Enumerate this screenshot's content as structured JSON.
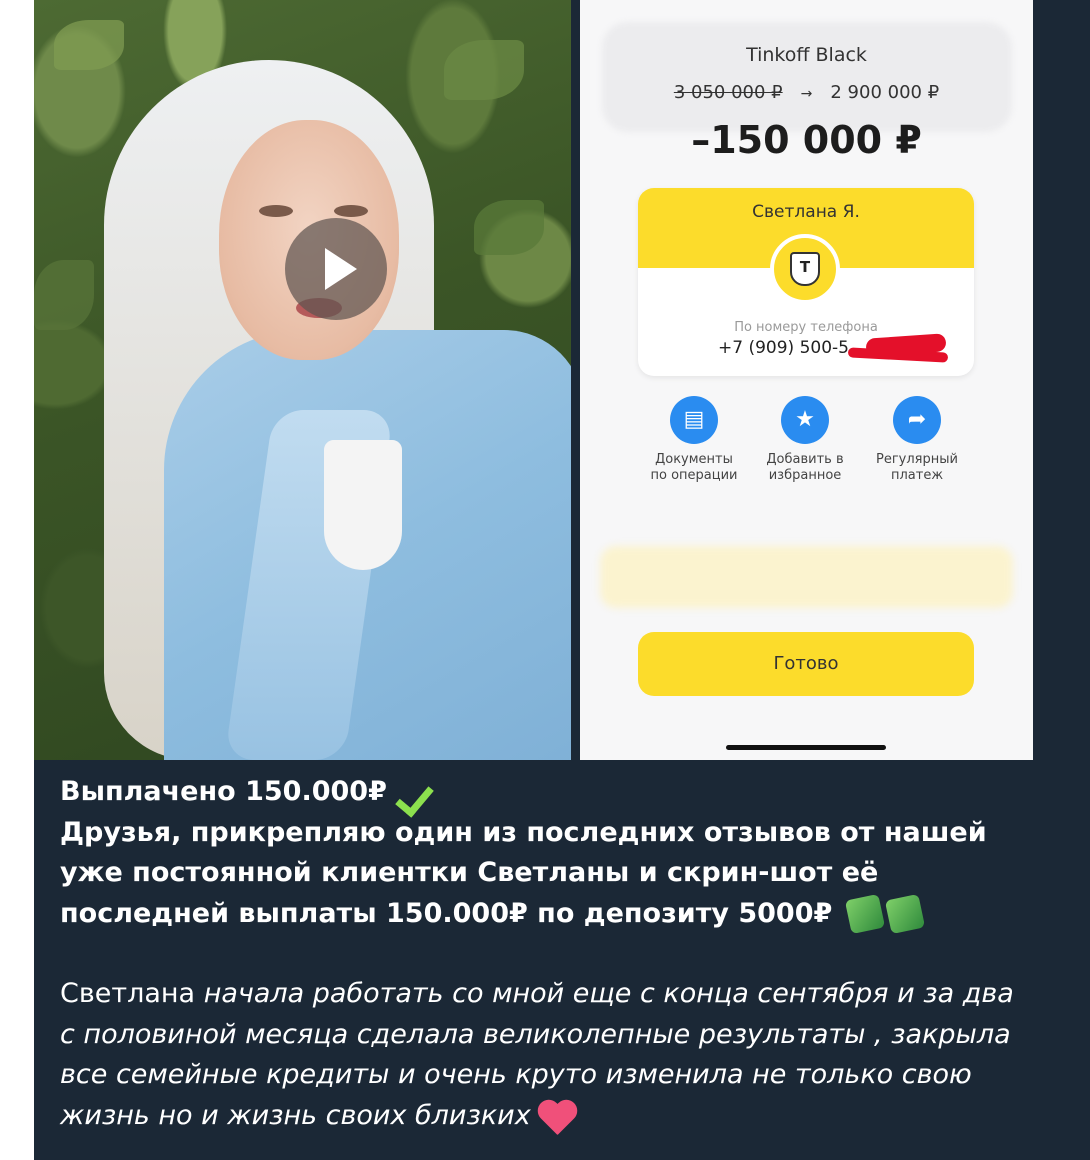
{
  "video": {
    "play_button": "play"
  },
  "phone": {
    "account_name": "Tinkoff Black",
    "balance_old": "3 050 000 ₽",
    "balance_arrow": "→",
    "balance_new": "2 900 000 ₽",
    "amount": "–150 000 ₽",
    "recipient_name": "Светлана Я.",
    "logo_letter": "Т",
    "phone_caption": "По номеру телефона",
    "phone_number": "+7 (909) 500-5",
    "actions": [
      {
        "icon": "document-icon",
        "glyph": "▤",
        "line1": "Документы",
        "line2": "по операции"
      },
      {
        "icon": "star-icon",
        "glyph": "★",
        "line1": "Добавить в",
        "line2": "избранное"
      },
      {
        "icon": "share-arrow-icon",
        "glyph": "➦",
        "line1": "Регулярный",
        "line2": "платеж"
      }
    ],
    "done_label": "Готово",
    "accent_yellow": "#fcdc2b",
    "accent_blue": "#2a8cf0"
  },
  "message": {
    "headline": "Выплачено 150.000₽",
    "body_bold": "Друзья, прикрепляю один из последних отзывов  от нашей уже постоянной клиентки Светланы и скрин-шот её последней выплаты 150.000₽ по депозиту 5000₽",
    "para2_regular": "Светлана ",
    "para2_italic": "начала работать со мной еще с конца сентября  и за два с половиной месяца сделала великолепные результаты , закрыла все семейные кредиты и очень круто изменила не только свою жизнь но и жизнь своих близких",
    "emojis": [
      "check-mark-icon",
      "money-icon",
      "money-icon",
      "heart-face-icon"
    ]
  }
}
